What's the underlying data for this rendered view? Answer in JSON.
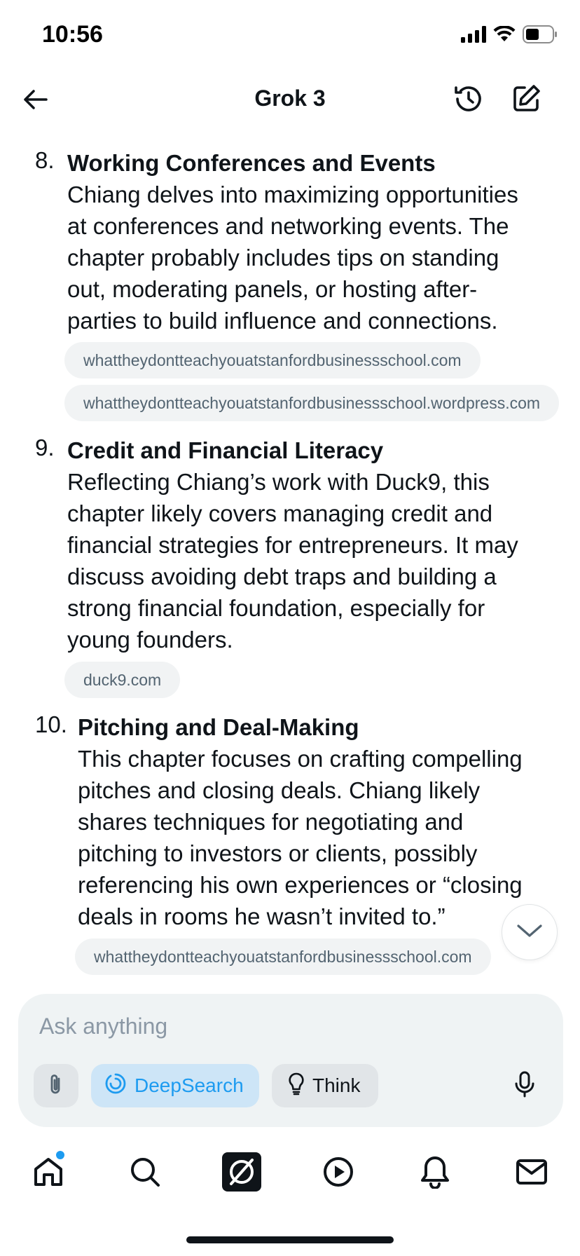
{
  "status_bar": {
    "time": "10:56",
    "icons": [
      "signal-icon",
      "wifi-icon",
      "battery-icon"
    ]
  },
  "header": {
    "title": "Grok 3",
    "icons": [
      "back-arrow-icon",
      "history-icon",
      "compose-icon"
    ]
  },
  "items": [
    {
      "number": "8.",
      "title": "Working Conferences and Events",
      "lines": [
        "Chiang delves into maximizing opportunities",
        "at conferences and networking events. The",
        "chapter probably includes tips on standing",
        "out, moderating panels, or hosting after-",
        "parties to build influence and connections."
      ],
      "sources": [
        "whattheydontteachyouatstanfordbusinessschool.com",
        "whattheydontteachyouatstanfordbusinessschool.wordpress.com"
      ]
    },
    {
      "number": "9.",
      "title": "Credit and Financial Literacy",
      "lines": [
        "Reflecting Chiang’s work with Duck9, this",
        "chapter likely covers managing credit and",
        "financial strategies for entrepreneurs. It may",
        "discuss avoiding debt traps and building a",
        "strong financial foundation, especially for",
        "young founders."
      ],
      "sources": [
        "duck9.com"
      ]
    },
    {
      "number": "10.",
      "title": "Pitching and Deal-Making",
      "lines": [
        "This chapter focuses on crafting compelling",
        "pitches and closing deals. Chiang likely",
        "shares techniques for negotiating and",
        "pitching to investors or clients, possibly",
        "referencing his own experiences or “closing",
        "deals in rooms he wasn’t invited to.”"
      ],
      "sources": [
        "whattheydontteachyouatstanfordbusinessschool.com"
      ]
    }
  ],
  "composer": {
    "placeholder": "Ask anything",
    "deepsearch_label": "DeepSearch",
    "think_label": "Think",
    "icons": [
      "paperclip-icon",
      "deepsearch-icon",
      "lightbulb-icon",
      "microphone-icon"
    ]
  },
  "bottom_nav": {
    "items": [
      "home-icon",
      "search-icon",
      "grok-icon",
      "play-icon",
      "bell-icon",
      "mail-icon"
    ],
    "home_has_notification": true
  },
  "colors": {
    "accent": "#1d9bf0",
    "text": "#0f1419",
    "muted": "#536471",
    "chip_bg": "#f1f3f4",
    "panel_bg": "#eff3f4"
  }
}
